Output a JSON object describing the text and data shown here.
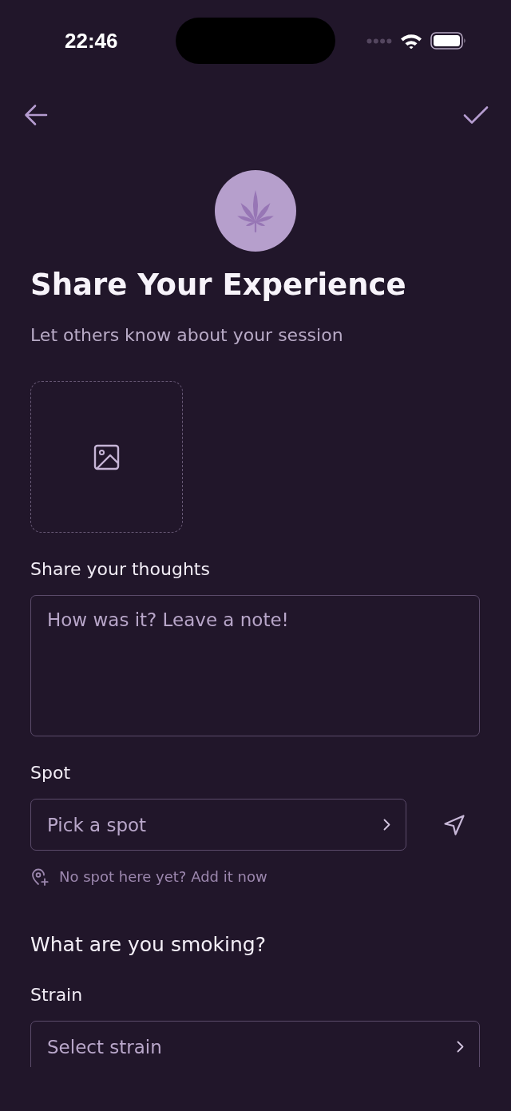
{
  "status_bar": {
    "time": "22:46"
  },
  "header": {
    "title": "Share Your Experience",
    "subtitle": "Let others know about your session"
  },
  "form": [
    {
      "kind": "textarea",
      "label": "Share your thoughts",
      "placeholder": "How was it? Leave a note!"
    },
    {
      "kind": "picker",
      "label": "Spot",
      "placeholder": "Pick a spot",
      "locate_button": true,
      "hint": "No spot here yet? Add it now"
    },
    {
      "kind": "section",
      "title": "What are you smoking?"
    },
    {
      "kind": "picker",
      "label": "Strain",
      "placeholder": "Select strain",
      "locate_button": false
    }
  ]
}
